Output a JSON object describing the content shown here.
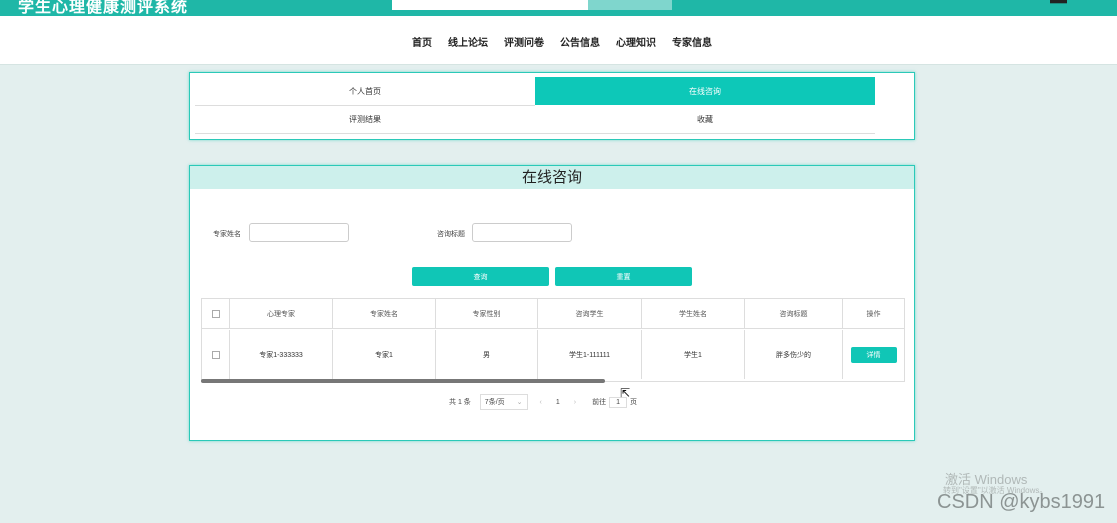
{
  "header": {
    "site_title": "学生心理健康测评系统",
    "top_icon": "user-icon"
  },
  "nav": {
    "items": [
      "首页",
      "线上论坛",
      "评测问卷",
      "公告信息",
      "心理知识",
      "专家信息"
    ]
  },
  "menu": {
    "items": [
      {
        "label": "个人首页",
        "active": false
      },
      {
        "label": "在线咨询",
        "active": true
      },
      {
        "label": "评测结果",
        "active": false
      },
      {
        "label": "收藏",
        "active": false
      }
    ]
  },
  "consult": {
    "title": "在线咨询",
    "filters": {
      "expert_name_label": "专家姓名",
      "expert_name_value": "",
      "consult_title_label": "咨询标题",
      "consult_title_value": ""
    },
    "buttons": {
      "query": "查询",
      "reset": "重置"
    },
    "table": {
      "headers": [
        "心理专家",
        "专家姓名",
        "专家性别",
        "咨询学生",
        "学生姓名",
        "咨询标题",
        "操作"
      ],
      "rows": [
        {
          "cells": [
            "专家1-333333",
            "专家1",
            "男",
            "学生1-111111",
            "学生1",
            "胖多伤少的"
          ],
          "action": "详情"
        }
      ]
    },
    "pager": {
      "total": "共 1 条",
      "page_size": "7条/页",
      "current_page": "1",
      "goto_label": "前往",
      "goto_value": "1",
      "page_unit": "页"
    }
  },
  "overlay": {
    "activate_title": "激活 Windows",
    "activate_sub": "转到\"设置\"以激活 Windows。",
    "csdn": "CSDN @kybs1991"
  },
  "colors": {
    "accent": "#10c6b6",
    "topbar": "#1fb7a7",
    "page_bg": "#e3efee"
  }
}
